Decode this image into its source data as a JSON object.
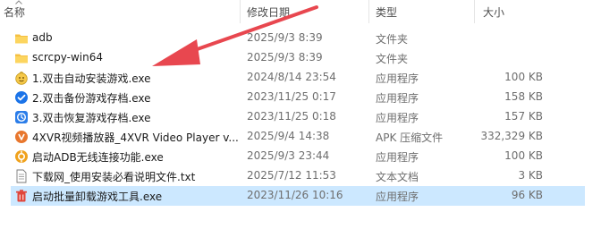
{
  "columns": {
    "name": "名称",
    "date": "修改日期",
    "type": "类型",
    "size": "大小"
  },
  "files": [
    {
      "name": "adb",
      "date": "2025/9/3 8:39",
      "type": "文件夹",
      "size": "",
      "icon": "folder-icon"
    },
    {
      "name": "scrcpy-win64",
      "date": "2025/9/3 8:39",
      "type": "文件夹",
      "size": "",
      "icon": "folder-icon"
    },
    {
      "name": "1.双击自动安装游戏.exe",
      "date": "2024/8/14 23:54",
      "type": "应用程序",
      "size": "100 KB",
      "icon": "emoji-app-icon"
    },
    {
      "name": "2.双击备份游戏存档.exe",
      "date": "2023/11/25 0:17",
      "type": "应用程序",
      "size": "158 KB",
      "icon": "check-app-icon"
    },
    {
      "name": "3.双击恢复游戏存档.exe",
      "date": "2023/11/25 0:18",
      "type": "应用程序",
      "size": "157 KB",
      "icon": "restore-app-icon"
    },
    {
      "name": "4XVR视频播放器_4XVR Video Player v...",
      "date": "2025/9/4 14:38",
      "type": "APK 压缩文件",
      "size": "332,329 KB",
      "icon": "apk-icon"
    },
    {
      "name": "启动ADB无线连接功能.exe",
      "date": "2025/9/3 23:44",
      "type": "应用程序",
      "size": "100 KB",
      "icon": "adb-app-icon"
    },
    {
      "name": "下载网_使用安装必看说明文件.txt",
      "date": "2025/7/12 11:53",
      "type": "文本文档",
      "size": "3 KB",
      "icon": "text-file-icon"
    },
    {
      "name": "启动批量卸载游戏工具.exe",
      "date": "2023/11/26 10:16",
      "type": "应用程序",
      "size": "96 KB",
      "icon": "trash-app-icon"
    }
  ],
  "colors": {
    "selection": "#cce8ff",
    "annotation_arrow": "#e8474f",
    "folder": "#f5c043"
  }
}
